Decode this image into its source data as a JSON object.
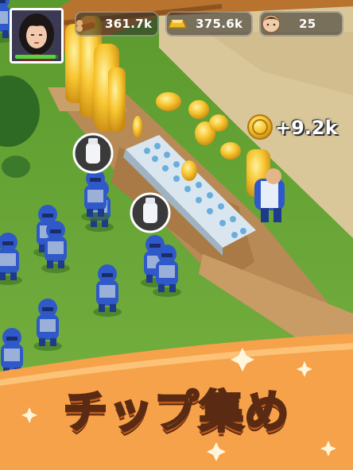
{
  "hud": {
    "wood": {
      "icon": "wood-log-icon",
      "value": "361.7k"
    },
    "gold": {
      "icon": "gold-ingot-icon",
      "value": "375.6k"
    },
    "population": {
      "icon": "villager-head-icon",
      "value": "25"
    }
  },
  "player": {
    "avatar": "player-portrait",
    "health_fraction": 0.95
  },
  "reward": {
    "icon": "gold-coin-icon",
    "text": "+9.2k"
  },
  "request_bubbles": [
    {
      "icon": "milk-bottle-icon"
    },
    {
      "icon": "milk-bottle-icon"
    }
  ],
  "banner": {
    "title": "チップ集め"
  },
  "colors": {
    "grass": "#6aa33a",
    "banner": "#f6a24a",
    "gold": "#f5c02a",
    "soldier": "#2f59c9"
  }
}
